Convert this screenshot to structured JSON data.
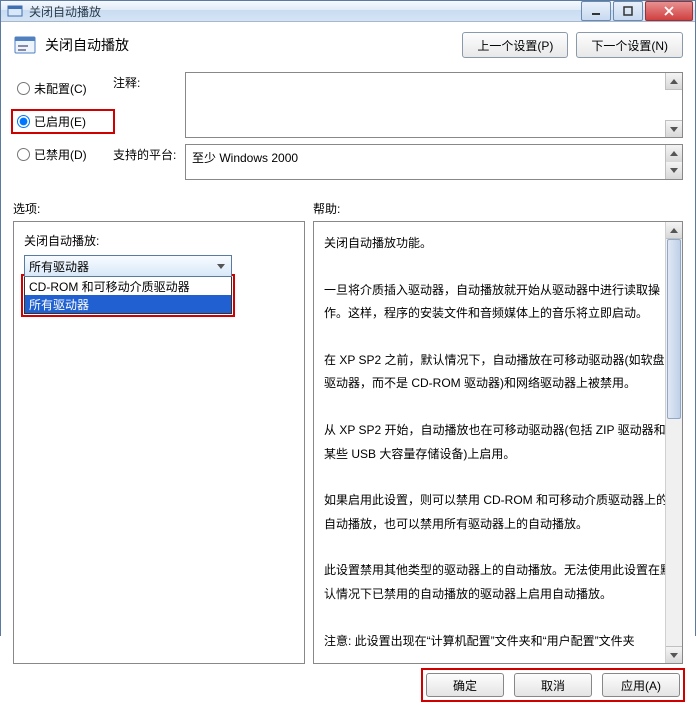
{
  "titlebar": {
    "text": "关闭自动播放"
  },
  "header": {
    "title": "关闭自动播放",
    "prev": "上一个设置(P)",
    "next": "下一个设置(N)"
  },
  "radios": {
    "unconfigured": "未配置(C)",
    "enabled": "已启用(E)",
    "disabled": "已禁用(D)"
  },
  "labels": {
    "comment": "注释:",
    "platform": "支持的平台:",
    "options": "选项:",
    "help": "帮助:"
  },
  "platform_value": "至少 Windows 2000",
  "options_panel": {
    "combo_label": "关闭自动播放:",
    "combo_value": "所有驱动器",
    "list": [
      "CD-ROM 和可移动介质驱动器",
      "所有驱动器"
    ]
  },
  "help_text": "关闭自动播放功能。\n\n一旦将介质插入驱动器，自动播放就开始从驱动器中进行读取操作。这样，程序的安装文件和音频媒体上的音乐将立即启动。\n\n在 XP SP2 之前，默认情况下，自动播放在可移动驱动器(如软盘驱动器，而不是 CD-ROM 驱动器)和网络驱动器上被禁用。\n\n从 XP SP2 开始，自动播放也在可移动驱动器(包括 ZIP 驱动器和某些 USB 大容量存储设备)上启用。\n\n如果启用此设置，则可以禁用 CD-ROM 和可移动介质驱动器上的自动播放，也可以禁用所有驱动器上的自动播放。\n\n此设置禁用其他类型的驱动器上的自动播放。无法使用此设置在默认情况下已禁用的自动播放的驱动器上启用自动播放。\n\n注意: 此设置出现在“计算机配置”文件夹和“用户配置”文件夹",
  "footer": {
    "ok": "确定",
    "cancel": "取消",
    "apply": "应用(A)"
  }
}
